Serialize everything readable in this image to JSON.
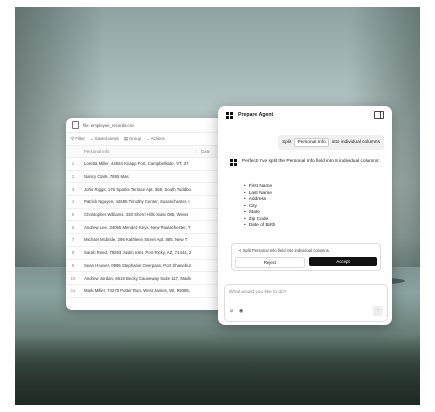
{
  "spreadsheet": {
    "file_title": "file: employee_records.csv",
    "toolbar": {
      "filter": "Filter",
      "saved_views": "Saved views",
      "group": "Group",
      "actions": "Actions"
    },
    "columns": [
      "Personal Info",
      "Date"
    ],
    "rows": [
      {
        "num": "1",
        "text": "Loretta Miller, 44634 Knapp Fort, Campbellside, VT, 37"
      },
      {
        "num": "2",
        "text": "Nancy Clark, 7865 Mas"
      },
      {
        "num": "3",
        "text": "John Riggs, 176 Sparks Terrace Apt. 368, South Toddbu"
      },
      {
        "num": "4",
        "text": "Patrick Nguyen, 44695 Timothy Center, Susanchester, I"
      },
      {
        "num": "5",
        "text": "Christopher Williams, 430 Sherri Hills Suite 085, Weiss"
      },
      {
        "num": "6",
        "text": "Andrew Lee, 34055 Mendez Keys, New Paulachester, T"
      },
      {
        "num": "7",
        "text": "Michael Mcbride, 296 Kathleen Street Apt. 885, New T"
      },
      {
        "num": "8",
        "text": "Sarah Reed, 79293 Justin Inlet, Port Ricky, AZ, 71444, 2"
      },
      {
        "num": "9",
        "text": "Sean Hoover, 0995 Stephanie Overpass, Port Shanebur"
      },
      {
        "num": "10",
        "text": "Andrew Jordan, 6619 Becky Causeway Suite 117, Mads"
      },
      {
        "num": "11",
        "text": "Mark Miller, 74270 Potter Run, West James, WI, 99385,"
      }
    ]
  },
  "agent": {
    "title": "Prepare Agent",
    "user_message": {
      "before": "Split",
      "chip": "Personal Info",
      "after": "into individual columns"
    },
    "reply": "Perfect! I've split the Personal Info field into 8 individual columns:",
    "fields": [
      "First Name",
      "Last Name",
      "Address",
      "City",
      "State",
      "Zip Code",
      "Date of Birth"
    ],
    "action_text": "Split Personal Info field into individual columns",
    "reject_label": "Reject",
    "accept_label": "Accept",
    "input_placeholder": "What would you like to do?"
  }
}
